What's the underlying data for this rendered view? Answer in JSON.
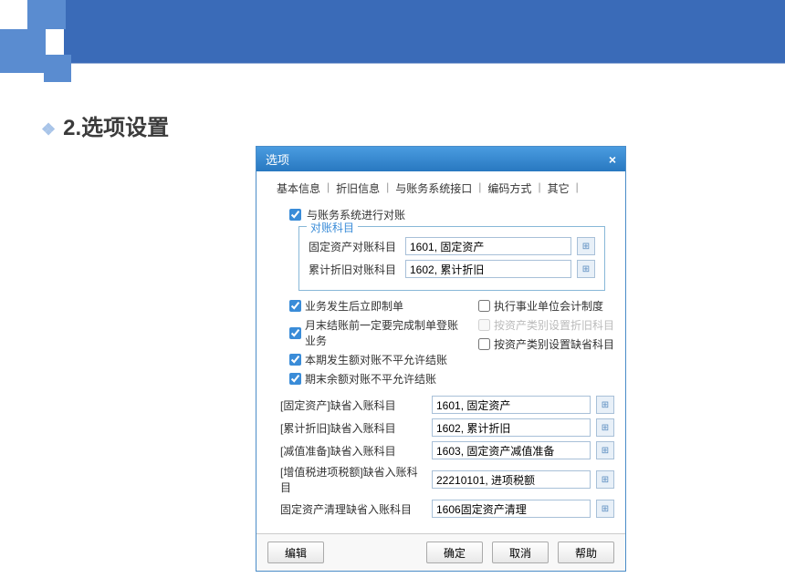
{
  "heading": {
    "bullet": "❖",
    "text": "2.选项设置"
  },
  "dialog": {
    "title": "选项",
    "tabs": [
      "基本信息",
      "折旧信息",
      "与账务系统接口",
      "编码方式",
      "其它"
    ],
    "reconcile_checkbox": "与账务系统进行对账",
    "fieldset_title": "对账科目",
    "fields_top": {
      "fixed_asset_label": "固定资产对账科目",
      "fixed_asset_value": "1601, 固定资产",
      "depreciation_label": "累计折旧对账科目",
      "depreciation_value": "1602, 累计折旧"
    },
    "left_checks": [
      "业务发生后立即制单",
      "月末结账前一定要完成制单登账业务",
      "本期发生额对账不平允许结账",
      "期末余额对账不平允许结账"
    ],
    "right_checks": [
      "执行事业单位会计制度",
      "按资产类别设置折旧科目",
      "按资产类别设置缺省科目"
    ],
    "lower_fields": [
      {
        "label": "[固定资产]缺省入账科目",
        "value": "1601, 固定资产"
      },
      {
        "label": "[累计折旧]缺省入账科目",
        "value": "1602, 累计折旧"
      },
      {
        "label": "[减值准备]缺省入账科目",
        "value": "1603, 固定资产减值准备"
      },
      {
        "label": "[增值税进项税额]缺省入账科目",
        "value": "22210101, 进项税额"
      },
      {
        "label": "固定资产清理缺省入账科目",
        "value": "1606固定资产清理"
      }
    ],
    "buttons": {
      "edit": "编辑",
      "ok": "确定",
      "cancel": "取消",
      "help": "帮助"
    }
  }
}
